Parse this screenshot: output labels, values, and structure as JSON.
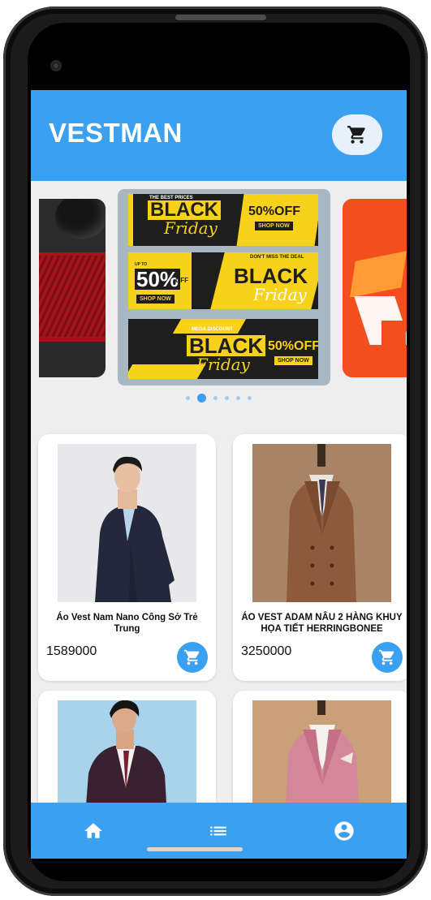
{
  "app": {
    "title": "VESTMAN",
    "accent_color": "#3aa0ef",
    "cart_icon": "cart-icon"
  },
  "carousel": {
    "slide_count": 6,
    "active_index": 1,
    "center_banner": {
      "cards": [
        {
          "tag": "THE BEST PRICES",
          "word": "BLACK",
          "script": "Friday",
          "offer": "50%OFF",
          "cta": "SHOP NOW"
        },
        {
          "tag": "DON'T MISS THE DEAL",
          "prefix": "UP TO",
          "percent": "50%",
          "off": "OFF",
          "cta": "SHOP NOW",
          "word": "BLACK",
          "script": "Friday"
        },
        {
          "tag": "MEGA DISCOUNT",
          "word": "BLACK",
          "script": "Friday",
          "offer": "50%OFF",
          "cta": "SHOP NOW"
        }
      ]
    }
  },
  "products": [
    {
      "name": "Áo Vest Nam Nano Công Sở Trẻ Trung",
      "price": "1589000"
    },
    {
      "name": "ÁO VEST ADAM NÂU 2 HÀNG KHUY HỌA TIẾT HERRINGBONEE",
      "price": "3250000"
    },
    {
      "name": "",
      "price": ""
    },
    {
      "name": "",
      "price": ""
    }
  ],
  "nav": {
    "items": [
      {
        "name": "home",
        "icon": "home-icon"
      },
      {
        "name": "list",
        "icon": "list-icon"
      },
      {
        "name": "account",
        "icon": "account-icon"
      }
    ]
  }
}
